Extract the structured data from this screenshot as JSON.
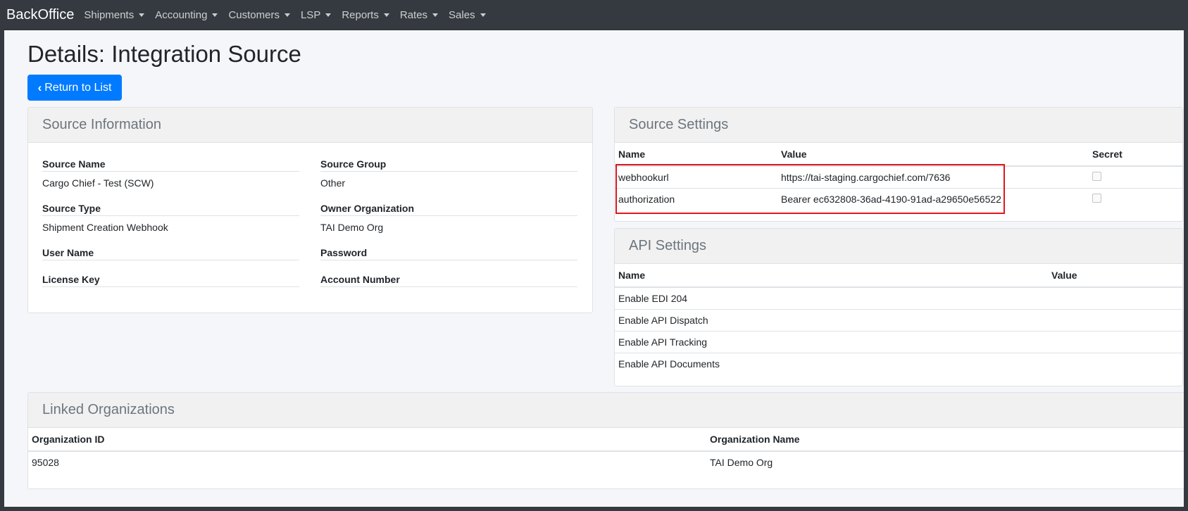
{
  "navbar": {
    "brand": "BackOffice",
    "menus": [
      "Shipments",
      "Accounting",
      "Customers",
      "LSP",
      "Reports",
      "Rates",
      "Sales"
    ]
  },
  "page": {
    "title": "Details: Integration Source",
    "return_label": "Return to List"
  },
  "source_info": {
    "header": "Source Information",
    "fields": [
      {
        "label": "Source Name",
        "value": "Cargo Chief - Test (SCW)"
      },
      {
        "label": "Source Group",
        "value": "Other"
      },
      {
        "label": "Source Type",
        "value": "Shipment Creation Webhook"
      },
      {
        "label": "Owner Organization",
        "value": "TAI Demo Org"
      },
      {
        "label": "User Name",
        "value": ""
      },
      {
        "label": "Password",
        "value": ""
      },
      {
        "label": "License Key",
        "value": ""
      },
      {
        "label": "Account Number",
        "value": ""
      }
    ]
  },
  "source_settings": {
    "header": "Source Settings",
    "columns": [
      "Name",
      "Value",
      "Secret"
    ],
    "rows": [
      {
        "name": "webhookurl",
        "value": "https://tai-staging.cargochief.com/7636",
        "secret": false
      },
      {
        "name": "authorization",
        "value": "Bearer ec632808-36ad-4190-91ad-a29650e56522",
        "secret": false
      }
    ]
  },
  "api_settings": {
    "header": "API Settings",
    "columns": [
      "Name",
      "Value"
    ],
    "rows": [
      {
        "name": "Enable EDI 204",
        "value": ""
      },
      {
        "name": "Enable API Dispatch",
        "value": ""
      },
      {
        "name": "Enable API Tracking",
        "value": ""
      },
      {
        "name": "Enable API Documents",
        "value": ""
      }
    ]
  },
  "linked_orgs": {
    "header": "Linked Organizations",
    "columns": [
      "Organization ID",
      "Organization Name"
    ],
    "rows": [
      {
        "id": "95028",
        "name": "TAI Demo Org"
      }
    ]
  },
  "colors": {
    "navbar": "#343a40",
    "primary": "#007bff",
    "highlight": "#e0161e"
  }
}
